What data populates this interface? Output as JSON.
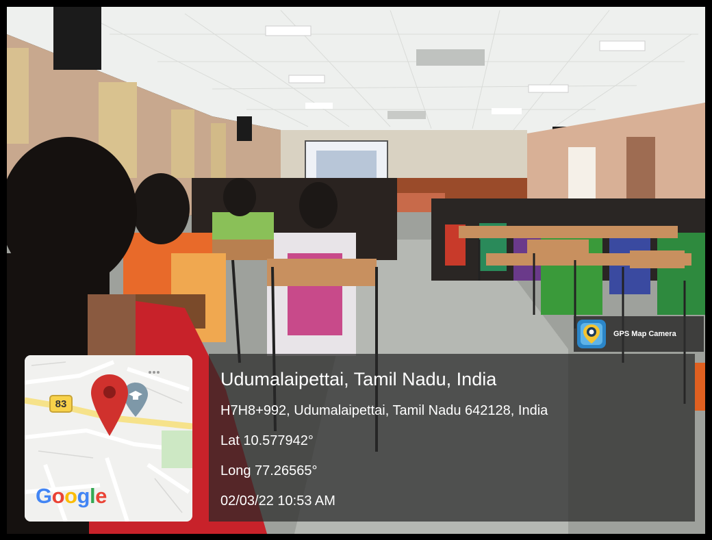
{
  "location": {
    "title": "Udumalaipettai, Tamil Nadu, India",
    "address": "H7H8+992, Udumalaipettai, Tamil Nadu 642128, India",
    "lat": "Lat 10.577942°",
    "long": "Long 77.26565°",
    "datetime": "02/03/22 10:53 AM"
  },
  "app_badge": {
    "label": "GPS Map Camera",
    "icon": "gps-map-camera-icon"
  },
  "map": {
    "road_number": "83",
    "logo_letters": [
      "G",
      "o",
      "o",
      "g",
      "l",
      "e"
    ],
    "logo_colors": [
      "#4285F4",
      "#EA4335",
      "#FBBC05",
      "#4285F4",
      "#34A853",
      "#EA4335"
    ],
    "pin_color": "#d0312d"
  }
}
